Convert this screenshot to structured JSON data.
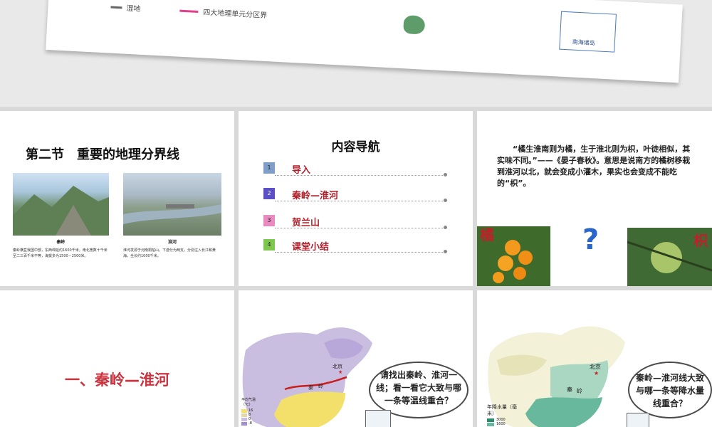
{
  "top_slide": {
    "legend_item1": "湿地",
    "legend_item2": "四大地理单元分区界",
    "inset_label": "南海诸岛"
  },
  "slide1": {
    "title": "第二节　重要的地理分界线",
    "photo1_caption": "秦岭",
    "photo1_text": "秦岭横亘我国中部，东西绵延约1600千米，南北宽数十千米至二三百千米不等，海拔多为1500－2500米。",
    "photo2_caption": "淮河",
    "photo2_text": "淮河发源于河南桐柏山，下游分为两支，分别注入长江和黄海，全长约1000千米。"
  },
  "slide2": {
    "title": "内容导航",
    "items": [
      {
        "num": "1",
        "label": "导入",
        "color": "#7f9fc9"
      },
      {
        "num": "2",
        "label": "秦岭—淮河",
        "color": "#5a4fc4"
      },
      {
        "num": "3",
        "label": "贺兰山",
        "color": "#e98ac0"
      },
      {
        "num": "4",
        "label": "课堂小结",
        "color": "#7ec850"
      }
    ]
  },
  "slide3": {
    "quote": "“橘生淮南则为橘，生于淮北则为枳，叶徒相似，其实味不同。”——《晏子春秋》。意思是说南方的橘树移栽到淮河以北，就会变成小灌木，果实也会变成不能吃的“枳”。",
    "left_label": "橘",
    "question_mark": "?",
    "right_label": "枳"
  },
  "slide4": {
    "heading": "一、秦岭—淮河"
  },
  "slide5": {
    "beijing": "北京",
    "qin": "秦",
    "ling": "岭",
    "legend_title": "平均气温（℃）",
    "legend_values": [
      "16",
      "8",
      "0",
      "-8"
    ],
    "bubble": "请找出秦岭、淮河一线；看一看它大致与哪一条等温线重合？"
  },
  "slide6": {
    "beijing": "北京",
    "qin": "秦",
    "ling": "岭",
    "legend_title": "年降水量（毫米）",
    "legend_values": [
      "3000",
      "1600"
    ],
    "bubble": "秦岭—淮河线大致与哪一条等降水量线重合？"
  }
}
